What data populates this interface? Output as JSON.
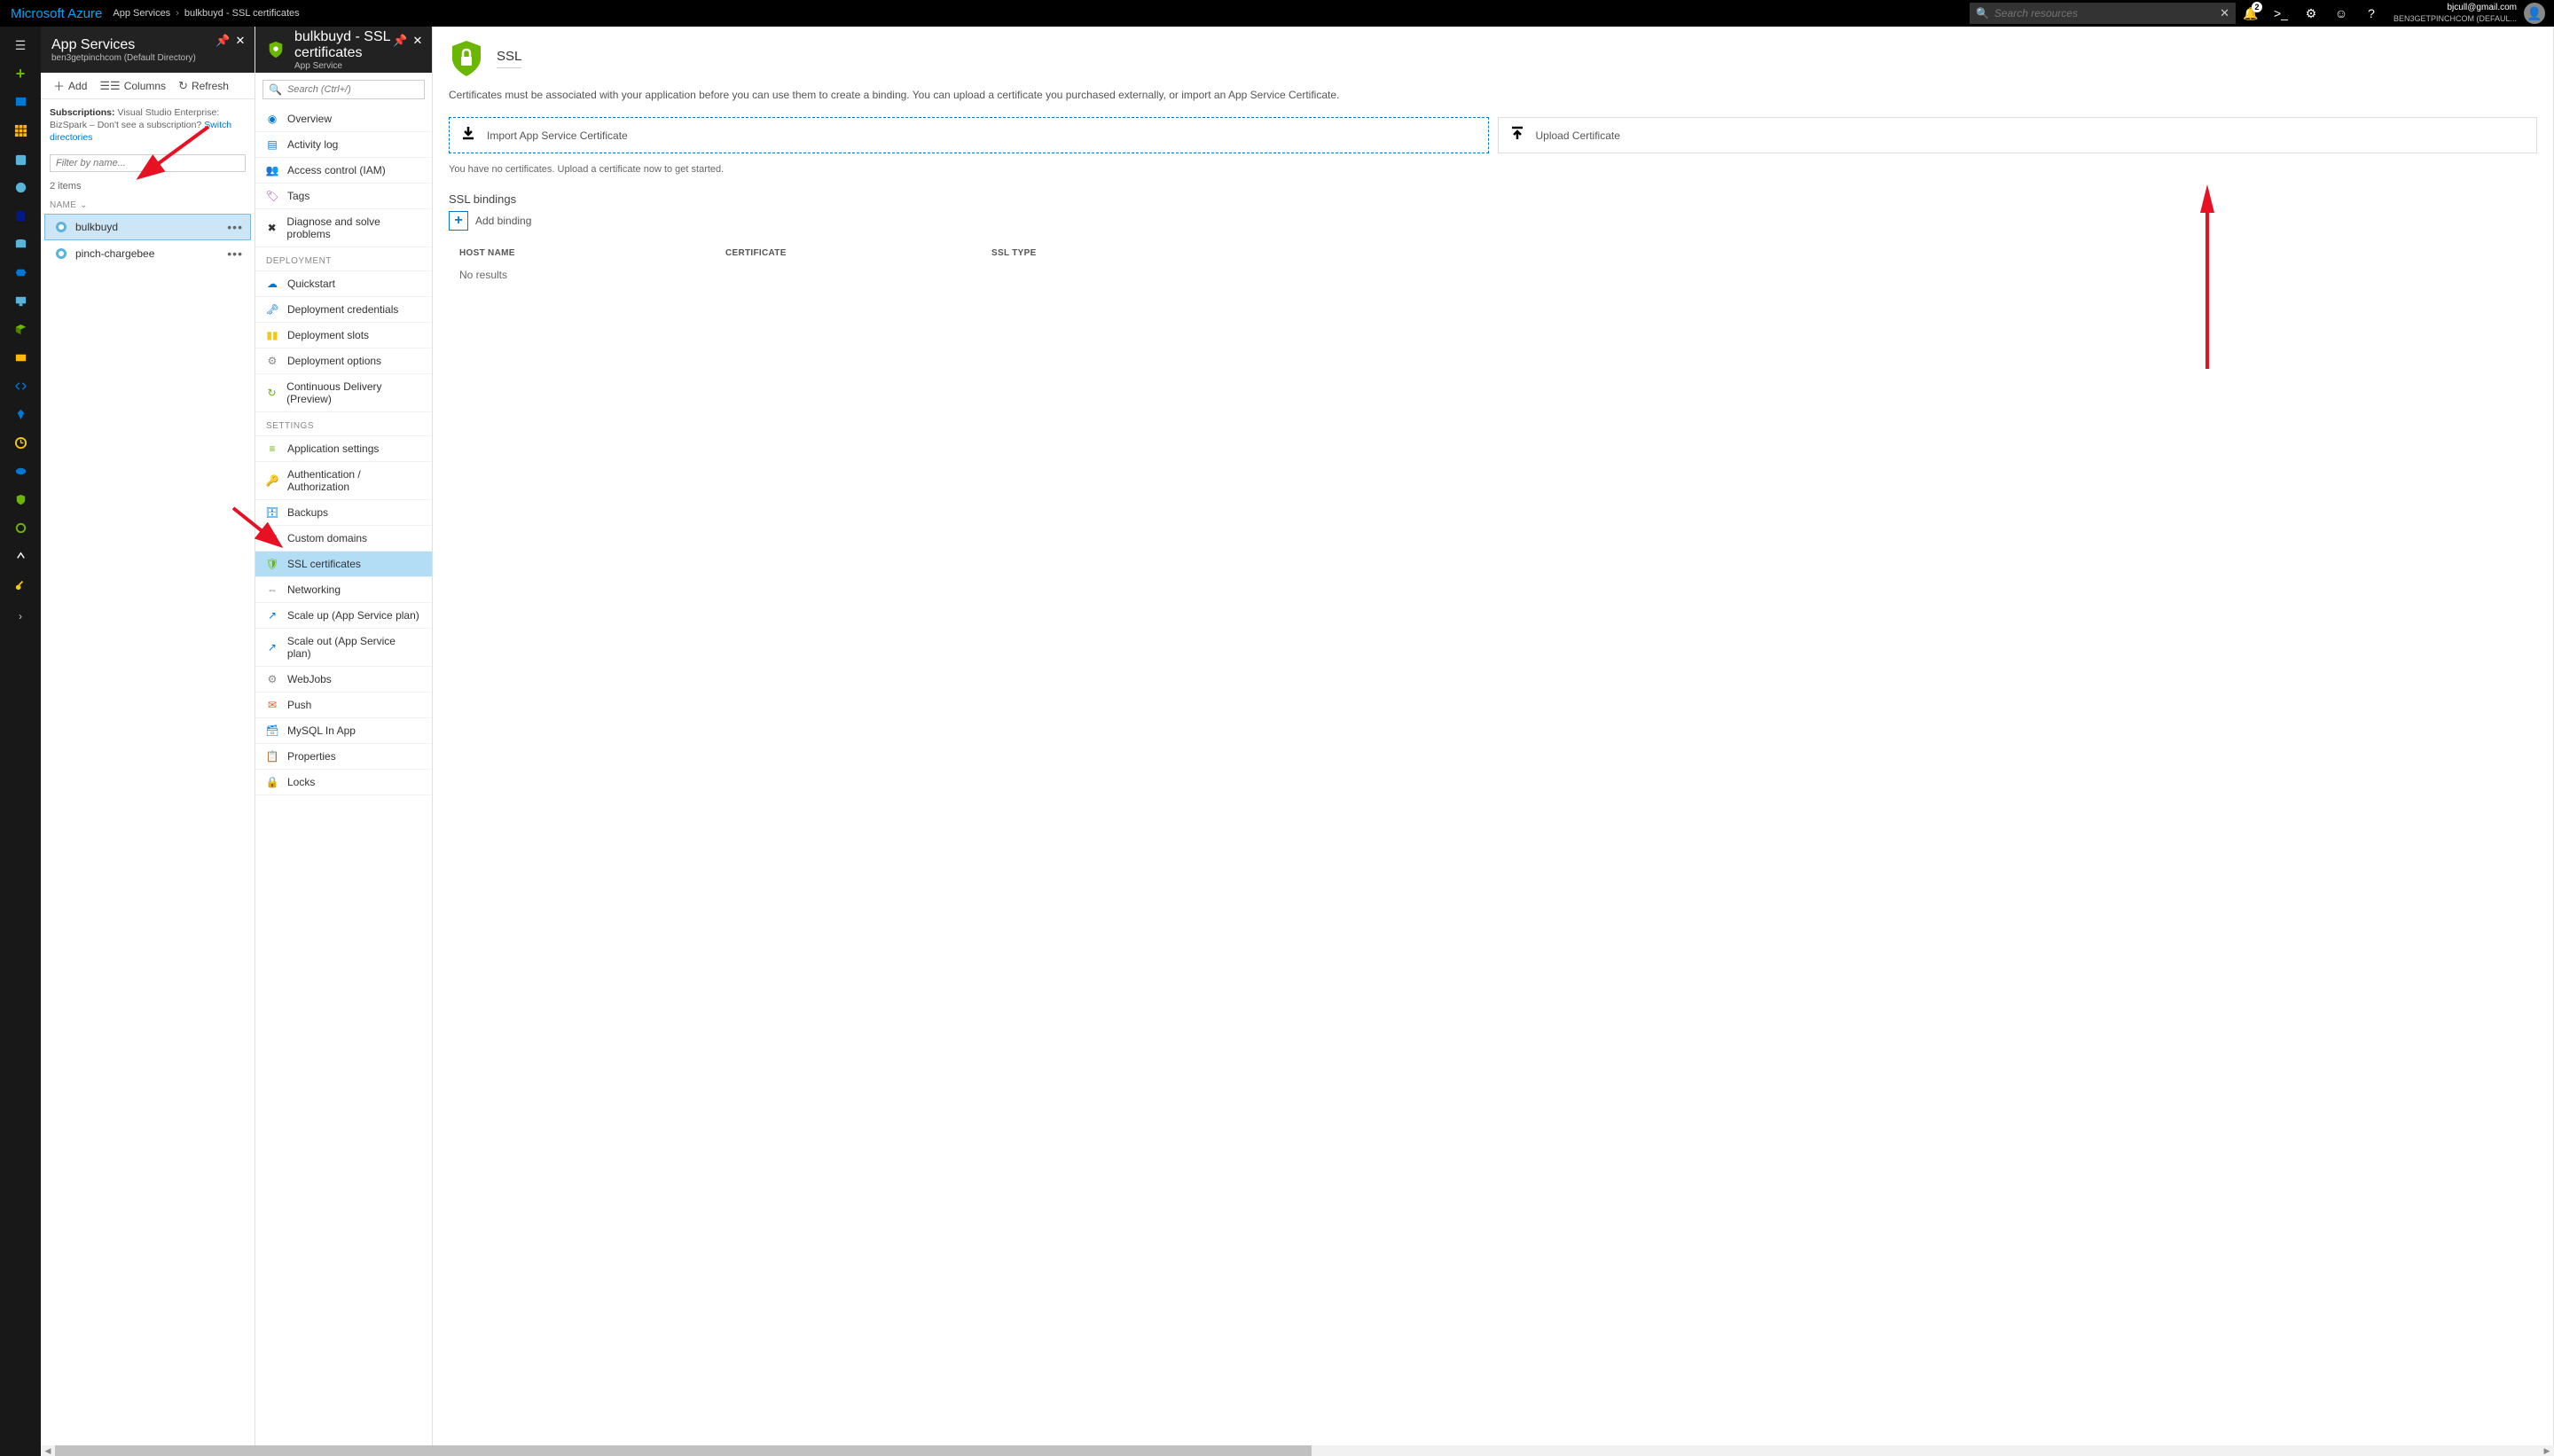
{
  "topbar": {
    "logo": "Microsoft Azure",
    "breadcrumb": [
      "App Services",
      "bulkbuyd - SSL certificates"
    ],
    "search_placeholder": "Search resources",
    "notification_count": "2",
    "user_email": "bjcull@gmail.com",
    "user_tenant": "BEN3GETPINCHCOM (DEFAUL..."
  },
  "blade1": {
    "title": "App Services",
    "subtitle": "ben3getpinchcom (Default Directory)",
    "toolbar": {
      "add": "Add",
      "columns": "Columns",
      "refresh": "Refresh"
    },
    "subscriptions_label": "Subscriptions:",
    "subscriptions_value": "Visual Studio Enterprise: BizSpark – Don't see a subscription?",
    "switch_link": "Switch directories",
    "filter_placeholder": "Filter by name...",
    "item_count": "2 items",
    "name_header": "NAME",
    "items": [
      {
        "name": "bulkbuyd",
        "selected": true
      },
      {
        "name": "pinch-chargebee",
        "selected": false
      }
    ]
  },
  "blade2": {
    "title": "bulkbuyd - SSL certificates",
    "subtitle": "App Service",
    "search_placeholder": "Search (Ctrl+/)",
    "sections": [
      {
        "label": null,
        "items": [
          {
            "label": "Overview",
            "color": "#0078d4",
            "glyph": "◉"
          },
          {
            "label": "Activity log",
            "color": "#0078d4",
            "glyph": "▤"
          },
          {
            "label": "Access control (IAM)",
            "color": "#0078d4",
            "glyph": "👥"
          },
          {
            "label": "Tags",
            "color": "#b146c2",
            "glyph": "🏷"
          },
          {
            "label": "Diagnose and solve problems",
            "color": "#333",
            "glyph": "✖"
          }
        ]
      },
      {
        "label": "DEPLOYMENT",
        "items": [
          {
            "label": "Quickstart",
            "color": "#0078d4",
            "glyph": "☁"
          },
          {
            "label": "Deployment credentials",
            "color": "#0078d4",
            "glyph": "🗝"
          },
          {
            "label": "Deployment slots",
            "color": "#f2c811",
            "glyph": "▮▮"
          },
          {
            "label": "Deployment options",
            "color": "#888",
            "glyph": "⚙"
          },
          {
            "label": "Continuous Delivery (Preview)",
            "color": "#6bb700",
            "glyph": "↻"
          }
        ]
      },
      {
        "label": "SETTINGS",
        "items": [
          {
            "label": "Application settings",
            "color": "#6bb700",
            "glyph": "≡"
          },
          {
            "label": "Authentication / Authorization",
            "color": "#f2c811",
            "glyph": "🔑"
          },
          {
            "label": "Backups",
            "color": "#0078d4",
            "glyph": "🗄"
          },
          {
            "label": "Custom domains",
            "color": "#0078d4",
            "glyph": "▦"
          },
          {
            "label": "SSL certificates",
            "color": "#6bb700",
            "glyph": "🛡",
            "selected": true
          },
          {
            "label": "Networking",
            "color": "#888",
            "glyph": "⇔"
          },
          {
            "label": "Scale up (App Service plan)",
            "color": "#0078d4",
            "glyph": "↗"
          },
          {
            "label": "Scale out (App Service plan)",
            "color": "#0078d4",
            "glyph": "↗"
          },
          {
            "label": "WebJobs",
            "color": "#888",
            "glyph": "⚙"
          },
          {
            "label": "Push",
            "color": "#f25022",
            "glyph": "✉"
          },
          {
            "label": "MySQL In App",
            "color": "#0078d4",
            "glyph": "🗃"
          },
          {
            "label": "Properties",
            "color": "#0078d4",
            "glyph": "📋"
          },
          {
            "label": "Locks",
            "color": "#888",
            "glyph": "🔒"
          }
        ]
      }
    ]
  },
  "blade3": {
    "title": "SSL",
    "description": "Certificates must be associated with your application before you can use them to create a binding. You can upload a certificate you purchased externally, or import an App Service Certificate.",
    "import_label": "Import App Service Certificate",
    "upload_label": "Upload Certificate",
    "empty_text": "You have no certificates. Upload a certificate now to get started.",
    "bindings_title": "SSL bindings",
    "add_binding_label": "Add binding",
    "table": {
      "cols": [
        "HOST NAME",
        "CERTIFICATE",
        "SSL TYPE"
      ],
      "no_results": "No results"
    }
  }
}
